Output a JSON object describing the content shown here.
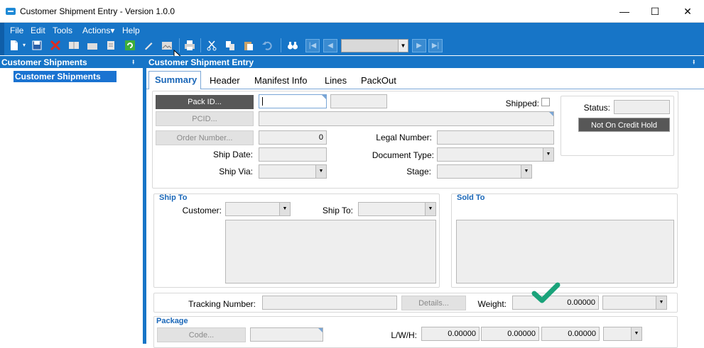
{
  "window": {
    "title": "Customer Shipment Entry - Version 1.0.0",
    "minimize": "—",
    "maximize": "☐",
    "close": "✕"
  },
  "menu": {
    "items": [
      "File",
      "Edit",
      "Tools",
      "Actions▾",
      "Help"
    ]
  },
  "left_pane": {
    "header": "Customer Shipments",
    "pin": "⭻",
    "tree_item": "Customer Shipments"
  },
  "right_pane": {
    "header": "Customer Shipment Entry",
    "pin": "⭻"
  },
  "tabs": [
    "Summary",
    "Header",
    "Manifest Info",
    "Lines",
    "PackOut"
  ],
  "summary": {
    "pack_id_button": "Pack ID...",
    "pcid_button": "PCID...",
    "order_number_button": "Order Number...",
    "order_number_value": "0",
    "ship_date_label": "Ship Date:",
    "ship_via_label": "Ship Via:",
    "legal_number_label": "Legal Number:",
    "document_type_label": "Document Type:",
    "stage_label": "Stage:",
    "shipped_label": "Shipped:",
    "status_label": "Status:",
    "credit_hold_button": "Not On Credit Hold"
  },
  "ship_to": {
    "title": "Ship To",
    "customer_label": "Customer:",
    "ship_to_label": "Ship To:"
  },
  "sold_to": {
    "title": "Sold To"
  },
  "tracking": {
    "tracking_label": "Tracking Number:",
    "details_button": "Details...",
    "weight_label": "Weight:",
    "weight_value": "0.00000"
  },
  "package": {
    "title": "Package",
    "code_button": "Code...",
    "lwh_label": "L/W/H:",
    "length": "0.00000",
    "width": "0.00000",
    "height": "0.00000"
  },
  "colors": {
    "chrome_blue": "#1775c7",
    "tab_blue": "#1a67b8",
    "checkmark_green": "#1aa37a"
  }
}
